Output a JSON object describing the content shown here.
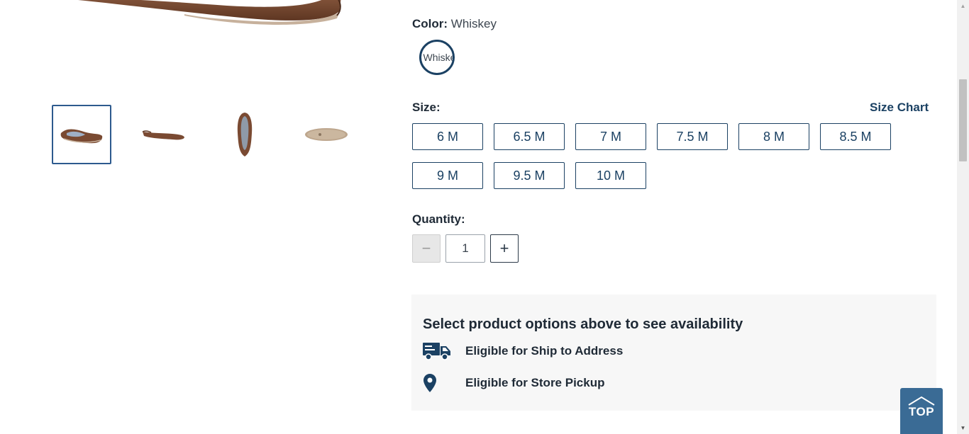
{
  "product": {
    "color_label": "Color:",
    "color_value": "Whiskey",
    "swatch_alt": "Whiskey",
    "size_label": "Size:",
    "size_chart_link": "Size Chart",
    "sizes": [
      "6 M",
      "6.5 M",
      "7 M",
      "7.5 M",
      "8 M",
      "8.5 M",
      "9 M",
      "9.5 M",
      "10 M"
    ],
    "quantity_label": "Quantity:",
    "quantity_value": "1",
    "quantity_minus": "−",
    "quantity_plus": "+"
  },
  "gallery": {
    "thumbnails": [
      "shoe-angle-view",
      "shoe-side-view",
      "shoe-top-view",
      "shoe-sole-view"
    ],
    "selected_index": 0
  },
  "availability": {
    "title": "Select product options above to see availability",
    "ship": "Eligible for Ship to Address",
    "pickup": "Eligible for Store Pickup"
  },
  "back_to_top": {
    "label": "TOP"
  },
  "colors": {
    "accent": "#1b4163",
    "top_button": "#3a6b95",
    "panel_bg": "#f7f7f7",
    "shoe_brown": "#7a4a32"
  }
}
